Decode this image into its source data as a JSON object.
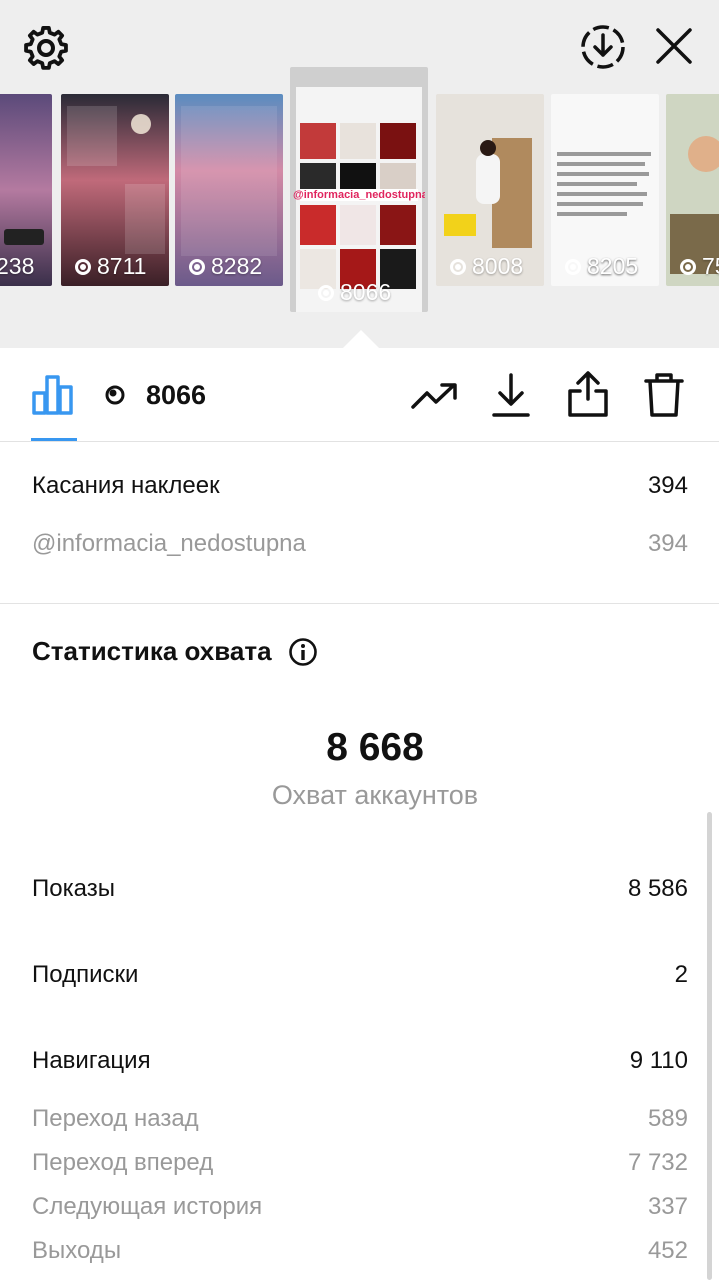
{
  "header": {
    "settings_icon": "gear-icon",
    "save_icon": "download-circle-icon",
    "close_icon": "close-icon"
  },
  "stories": [
    {
      "views": "238"
    },
    {
      "views": "8711"
    },
    {
      "views": "8282"
    },
    {
      "views": "8066",
      "tag": "@informacia_nedostupna"
    },
    {
      "views": "8008"
    },
    {
      "views": "8205"
    },
    {
      "views": "75"
    }
  ],
  "toolbar": {
    "views_count": "8066",
    "insights_icon": "bar-chart-icon",
    "trend_icon": "trending-up-icon",
    "download_icon": "download-icon",
    "share_icon": "share-icon",
    "delete_icon": "trash-icon"
  },
  "sticker_taps": {
    "label": "Касания наклеек",
    "value": "394",
    "items": [
      {
        "label": "@informacia_nedostupna",
        "value": "394"
      }
    ]
  },
  "reach": {
    "title": "Статистика охвата",
    "number": "8 668",
    "label": "Охват аккаунтов"
  },
  "metrics": {
    "impressions": {
      "label": "Показы",
      "value": "8 586"
    },
    "follows": {
      "label": "Подписки",
      "value": "2"
    },
    "navigation": {
      "label": "Навигация",
      "value": "9 110",
      "items": [
        {
          "label": "Переход назад",
          "value": "589"
        },
        {
          "label": "Переход вперед",
          "value": "7 732"
        },
        {
          "label": "Следующая история",
          "value": "337"
        },
        {
          "label": "Выходы",
          "value": "452"
        }
      ]
    }
  },
  "colors": {
    "accent": "#3897f0",
    "muted_text": "#999999"
  }
}
